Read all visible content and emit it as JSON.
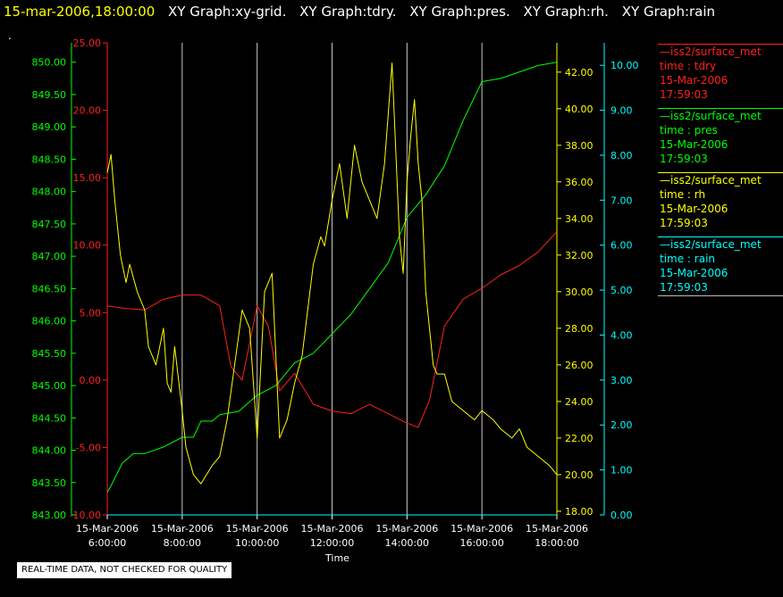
{
  "header": {
    "timestamp": "15-mar-2006,18:00:00",
    "tabs": [
      {
        "label": "XY Graph:xy-grid."
      },
      {
        "label": "XY Graph:tdry."
      },
      {
        "label": "XY Graph:pres."
      },
      {
        "label": "XY Graph:rh."
      },
      {
        "label": "XY Graph:rain"
      }
    ],
    "dot": "."
  },
  "legend": [
    {
      "source": "—iss2/surface_met",
      "var": "time : tdry",
      "date": "15-Mar-2006",
      "time": "17:59:03",
      "color": "#ff2020"
    },
    {
      "source": "—iss2/surface_met",
      "var": "time : pres",
      "date": "15-Mar-2006",
      "time": "17:59:03",
      "color": "#00ff00"
    },
    {
      "source": "—iss2/surface_met",
      "var": "time : rh",
      "date": "15-Mar-2006",
      "time": "17:59:03",
      "color": "#ffff00"
    },
    {
      "source": "—iss2/surface_met",
      "var": "time : rain",
      "date": "15-Mar-2006",
      "time": "17:59:03",
      "color": "#00ffff"
    }
  ],
  "footer": {
    "quality_note": "REAL-TIME DATA, NOT CHECKED FOR QUALITY"
  },
  "chart_data": {
    "type": "line",
    "xlabel": "Time",
    "x_ticks": [
      {
        "date": "15-Mar-2006",
        "time": "6:00:00",
        "hour": 6
      },
      {
        "date": "15-Mar-2006",
        "time": "8:00:00",
        "hour": 8
      },
      {
        "date": "15-Mar-2006",
        "time": "10:00:00",
        "hour": 10
      },
      {
        "date": "15-Mar-2006",
        "time": "12:00:00",
        "hour": 12
      },
      {
        "date": "15-Mar-2006",
        "time": "14:00:00",
        "hour": 14
      },
      {
        "date": "15-Mar-2006",
        "time": "16:00:00",
        "hour": 16
      },
      {
        "date": "15-Mar-2006",
        "time": "18:00:00",
        "hour": 18
      }
    ],
    "xlim": [
      6,
      18
    ],
    "grid": "vertical",
    "axes": {
      "tdry": {
        "range": [
          -10,
          25
        ],
        "ticks": [
          "-10.00",
          "-5.00",
          "0.00",
          "5.00",
          "10.00",
          "15.00",
          "20.00",
          "25.00"
        ],
        "color": "#ff2020"
      },
      "pres": {
        "range": [
          843,
          850.3
        ],
        "ticks": [
          "843.00",
          "843.50",
          "844.00",
          "844.50",
          "845.00",
          "845.50",
          "846.00",
          "846.50",
          "847.00",
          "847.50",
          "848.00",
          "848.50",
          "849.00",
          "849.50",
          "850.00"
        ],
        "color": "#00ff00"
      },
      "rh": {
        "range": [
          17.8,
          43.6
        ],
        "ticks": [
          "18.00",
          "20.00",
          "22.00",
          "24.00",
          "26.00",
          "28.00",
          "30.00",
          "32.00",
          "34.00",
          "36.00",
          "38.00",
          "40.00",
          "42.00"
        ],
        "color": "#ffff00"
      },
      "rain": {
        "range": [
          0,
          10.5
        ],
        "ticks": [
          "0.00",
          "1.00",
          "2.00",
          "3.00",
          "4.00",
          "5.00",
          "6.00",
          "7.00",
          "8.00",
          "9.00",
          "10.00"
        ],
        "color": "#00ffff"
      }
    },
    "series": [
      {
        "name": "tdry",
        "axis": "tdry",
        "color": "#ff2020",
        "x": [
          6.0,
          6.5,
          7.0,
          7.5,
          8.0,
          8.5,
          9.0,
          9.3,
          9.6,
          10.0,
          10.3,
          10.6,
          11.0,
          11.5,
          12.0,
          12.5,
          13.0,
          13.5,
          14.0,
          14.3,
          14.6,
          15.0,
          15.5,
          16.0,
          16.5,
          17.0,
          17.5,
          18.0
        ],
        "y": [
          5.5,
          5.3,
          5.2,
          6.0,
          6.3,
          6.3,
          5.5,
          1.0,
          0.0,
          5.5,
          4.0,
          -0.8,
          0.5,
          -1.8,
          -2.3,
          -2.5,
          -1.8,
          -2.5,
          -3.2,
          -3.5,
          -1.5,
          4.0,
          6.0,
          6.8,
          7.8,
          8.5,
          9.5,
          11.0
        ]
      },
      {
        "name": "pres",
        "axis": "pres",
        "color": "#00ff00",
        "x": [
          6.0,
          6.1,
          6.4,
          6.7,
          7.0,
          7.5,
          8.0,
          8.3,
          8.5,
          8.8,
          9.0,
          9.5,
          10.0,
          10.5,
          11.0,
          11.5,
          12.0,
          12.5,
          13.0,
          13.5,
          14.0,
          14.5,
          15.0,
          15.5,
          16.0,
          16.5,
          17.0,
          17.5,
          18.0
        ],
        "y": [
          843.35,
          843.45,
          843.8,
          843.95,
          843.95,
          844.05,
          844.2,
          844.2,
          844.45,
          844.45,
          844.55,
          844.6,
          844.85,
          845.0,
          845.35,
          845.5,
          845.8,
          846.1,
          846.5,
          846.9,
          847.6,
          847.95,
          848.4,
          849.1,
          849.7,
          849.75,
          849.85,
          849.95,
          850.0
        ]
      },
      {
        "name": "rh",
        "axis": "rh",
        "color": "#ffff00",
        "x": [
          6.0,
          6.1,
          6.2,
          6.35,
          6.5,
          6.6,
          6.8,
          7.0,
          7.1,
          7.3,
          7.5,
          7.6,
          7.7,
          7.8,
          8.0,
          8.1,
          8.3,
          8.5,
          8.8,
          9.0,
          9.2,
          9.4,
          9.6,
          9.8,
          10.0,
          10.2,
          10.4,
          10.6,
          10.8,
          11.0,
          11.2,
          11.5,
          11.7,
          11.8,
          12.0,
          12.2,
          12.4,
          12.6,
          12.8,
          13.0,
          13.2,
          13.4,
          13.6,
          13.8,
          13.9,
          14.0,
          14.1,
          14.2,
          14.3,
          14.4,
          14.5,
          14.6,
          14.7,
          14.8,
          15.0,
          15.2,
          15.5,
          15.8,
          16.0,
          16.3,
          16.5,
          16.8,
          17.0,
          17.2,
          17.5,
          17.8,
          18.0
        ],
        "y": [
          36.5,
          37.5,
          35.0,
          32.0,
          30.5,
          31.5,
          30.0,
          29.0,
          27.0,
          26.0,
          28.0,
          25.0,
          24.5,
          27.0,
          23.5,
          21.5,
          20.0,
          19.5,
          20.5,
          21.0,
          23.0,
          26.0,
          29.0,
          28.0,
          22.0,
          30.0,
          31.0,
          22.0,
          23.0,
          25.0,
          26.5,
          31.5,
          33.0,
          32.5,
          35.0,
          37.0,
          34.0,
          38.0,
          36.0,
          35.0,
          34.0,
          37.0,
          42.5,
          33.0,
          31.0,
          36.0,
          38.5,
          40.5,
          37.0,
          35.0,
          30.0,
          28.0,
          26.0,
          25.5,
          25.5,
          24.0,
          23.5,
          23.0,
          23.5,
          23.0,
          22.5,
          22.0,
          22.5,
          21.5,
          21.0,
          20.5,
          20.0
        ]
      },
      {
        "name": "rain",
        "axis": "rain",
        "color": "#00ffff",
        "x": [
          6.0,
          18.0
        ],
        "y": [
          0.0,
          0.0
        ]
      }
    ]
  }
}
